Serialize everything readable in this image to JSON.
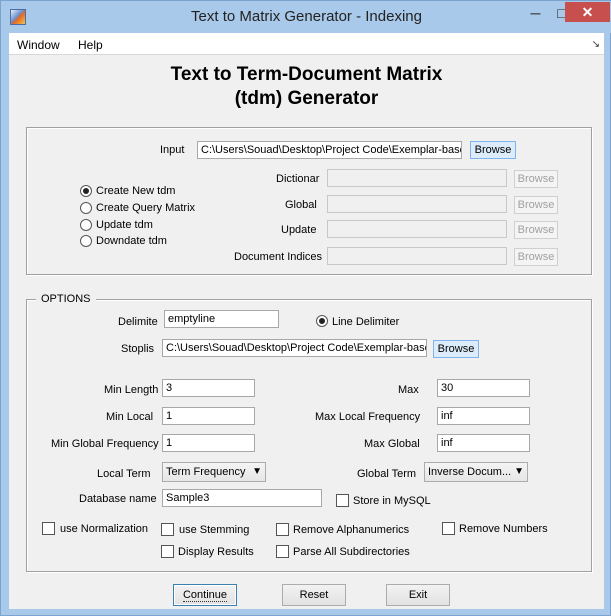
{
  "window": {
    "title": "Text to Matrix Generator - Indexing",
    "minimize": "─",
    "maximize": "□",
    "close": "✕"
  },
  "menu": {
    "window": "Window",
    "help": "Help",
    "dock": "↘"
  },
  "heading": {
    "line1": "Text to Term-Document Matrix",
    "line2": "(tdm) Generator"
  },
  "input_panel": {
    "input_label": "Input",
    "input_value": "C:\\Users\\Souad\\Desktop\\Project Code\\Exemplar-based",
    "browse": "Browse",
    "modes": [
      {
        "label": "Create New tdm",
        "selected": true
      },
      {
        "label": "Create Query Matrix",
        "selected": false
      },
      {
        "label": "Update tdm",
        "selected": false
      },
      {
        "label": "Downdate tdm",
        "selected": false
      }
    ],
    "dictionar_label": "Dictionar",
    "global_label": "Global",
    "update_label": "Update",
    "docidx_label": "Document Indices"
  },
  "options": {
    "title": "OPTIONS",
    "delimiter_label": "Delimite",
    "delimiter_value": "emptyline",
    "line_delimiter_label": "Line Delimiter",
    "line_delimiter_selected": true,
    "stoplist_label": "Stoplis",
    "stoplist_value": "C:\\Users\\Souad\\Desktop\\Project Code\\Exemplar-based",
    "stoplist_browse": "Browse",
    "min_length_label": "Min Length",
    "min_length": "3",
    "max_label": "Max",
    "max": "30",
    "min_local_label": "Min Local",
    "min_local": "1",
    "max_local_freq_label": "Max Local Frequency",
    "max_local_freq": "inf",
    "min_global_freq_label": "Min Global Frequency",
    "min_global_freq": "1",
    "max_global_label": "Max Global",
    "max_global": "inf",
    "local_term_label": "Local Term",
    "local_term": "Term Frequency",
    "global_term_label": "Global Term",
    "global_term": "Inverse Docum...",
    "database_label": "Database name",
    "database": "Sample3",
    "store_mysql": "Store in MySQL",
    "use_normalization": "use Normalization",
    "use_stemming": "use Stemming",
    "remove_alphanumerics": "Remove Alphanumerics",
    "remove_numbers": "Remove Numbers",
    "display_results": "Display Results",
    "parse_subdirs": "Parse All Subdirectories"
  },
  "actions": {
    "continue": "Continue",
    "reset": "Reset",
    "exit": "Exit"
  }
}
